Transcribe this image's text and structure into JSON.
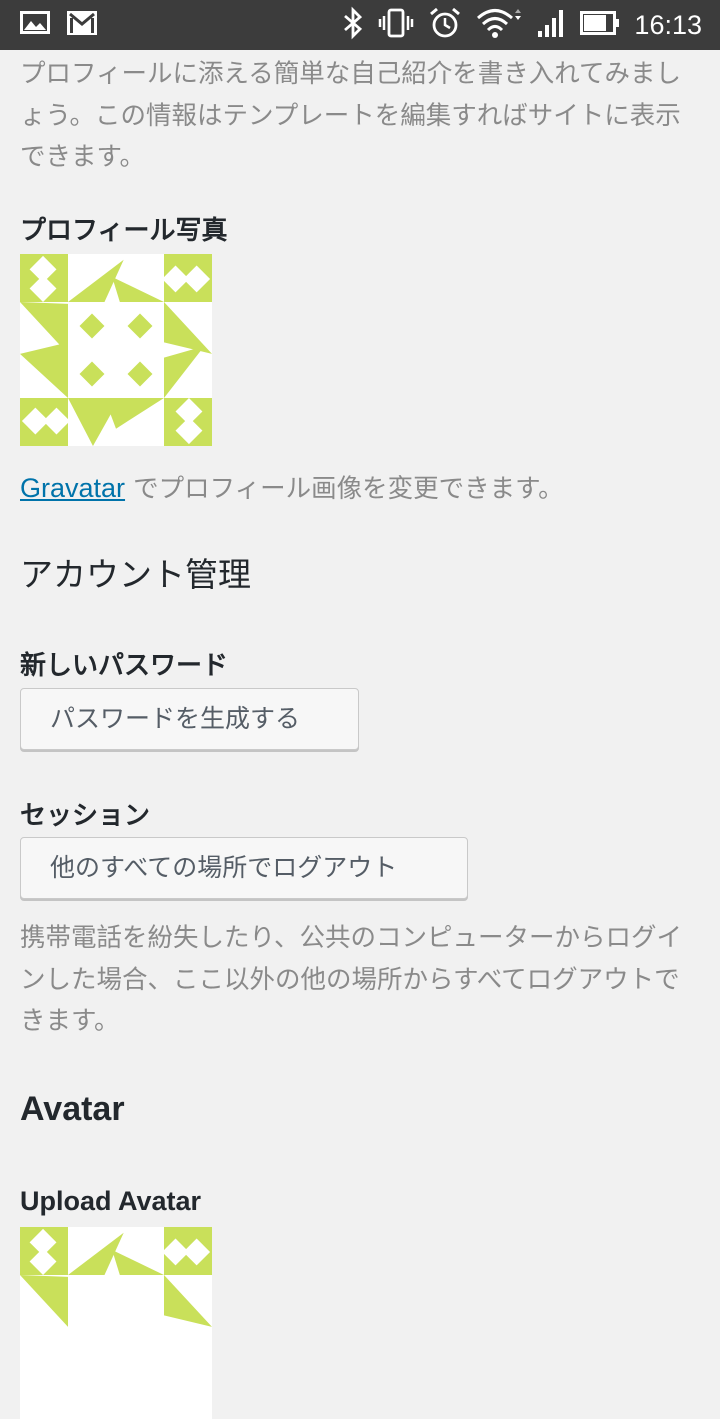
{
  "status_bar": {
    "time": "16:13",
    "left_icons": [
      "image-icon",
      "gmail-icon"
    ],
    "right_icons": [
      "bluetooth-icon",
      "vibrate-icon",
      "alarm-icon",
      "wifi-icon",
      "signal-icon",
      "battery-icon"
    ]
  },
  "profile": {
    "bio_description": "プロフィールに添える簡単な自己紹介を書き入れてみましょう。この情報はテンプレートを編集すればサイトに表示できます。",
    "photo_label": "プロフィール写真",
    "gravatar_link": "Gravatar",
    "gravatar_text": " でプロフィール画像を変更できます。"
  },
  "account": {
    "heading": "アカウント管理",
    "new_password_label": "新しいパスワード",
    "generate_password_button": "パスワードを生成する",
    "sessions_label": "セッション",
    "logout_everywhere_button": "他のすべての場所でログアウト",
    "sessions_description": "携帯電話を紛失したり、公共のコンピューターからログインした場合、ここ以外の他の場所からすべてログアウトできます。"
  },
  "avatar": {
    "heading": "Avatar",
    "upload_label": "Upload Avatar"
  },
  "colors": {
    "identicon": "#c9e05a",
    "link": "#0073aa",
    "background": "#f1f1f1",
    "status_bar": "#3c3c3c"
  }
}
